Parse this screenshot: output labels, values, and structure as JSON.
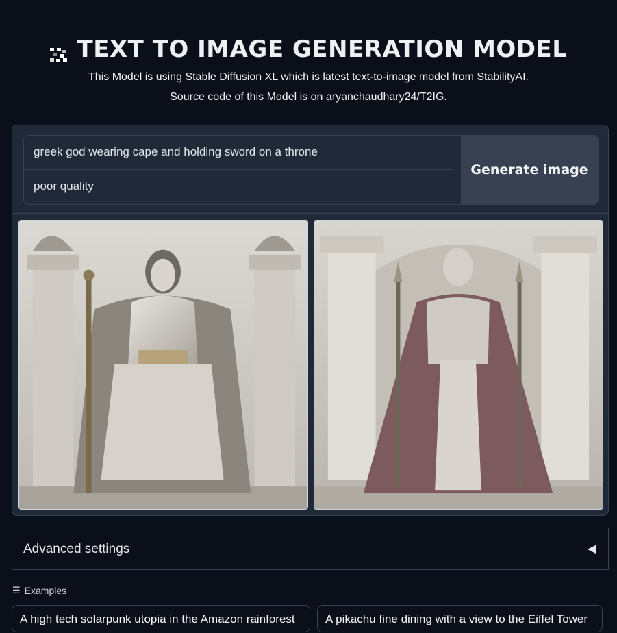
{
  "header": {
    "title": "TEXT TO IMAGE GENERATION MODEL",
    "title_icon": "qr-pixel-icon",
    "subtitle_line1": "This Model is using Stable Diffusion XL which is latest text-to-image model from StabilityAI.",
    "subtitle_line2_prefix": "Source code of this Model is on ",
    "subtitle_link": "aryanchaudhary24/T2IG",
    "subtitle_line2_suffix": "."
  },
  "prompt": {
    "positive": "greek god wearing cape and holding sword on a throne",
    "negative": "poor quality"
  },
  "generate_button": "Generate image",
  "gallery": [
    {
      "description_icon": "seated-greek-god-statue-image"
    },
    {
      "description_icon": "standing-greek-god-statue-image"
    }
  ],
  "advanced": {
    "label": "Advanced settings",
    "arrow": "◀"
  },
  "examples": {
    "header": "Examples",
    "icon": "list-icon",
    "items": [
      "A high tech solarpunk utopia in the Amazon rainforest",
      "A pikachu fine dining with a view to the Eiffel Tower"
    ]
  }
}
